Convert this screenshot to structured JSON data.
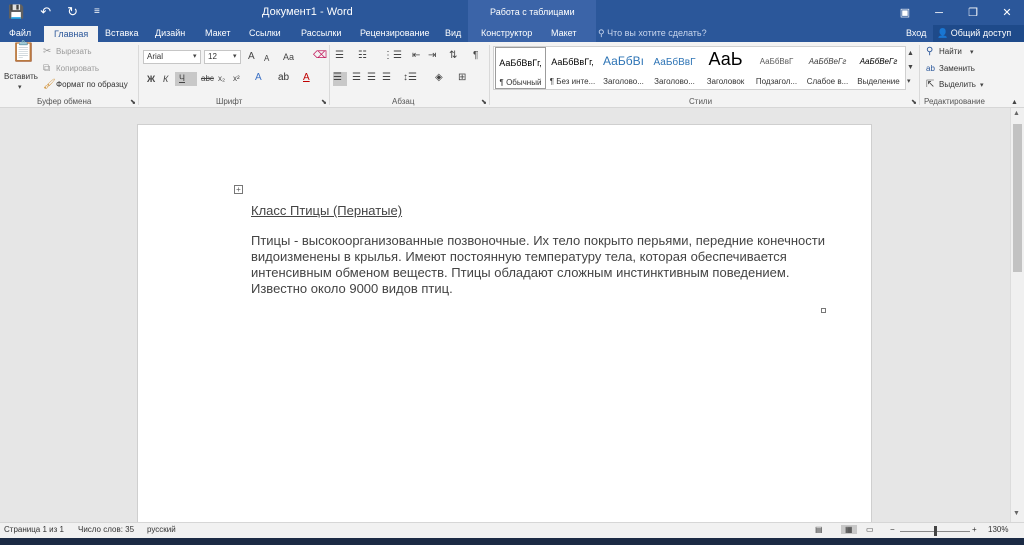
{
  "app": {
    "title": "Документ1 - Word",
    "context_tab_title": "Работа с таблицами",
    "qat": {
      "save": "💾",
      "undo": "↶",
      "redo": "↻",
      "customize": "≡"
    }
  },
  "tabs": [
    "Файл",
    "Главная",
    "Вставка",
    "Дизайн",
    "Макет",
    "Ссылки",
    "Рассылки",
    "Рецензирование",
    "Вид",
    "Конструктор",
    "Макет"
  ],
  "tell_me": "Что вы хотите сделать?",
  "sign_in": "Вход",
  "share": "Общий доступ",
  "ribbon": {
    "clipboard": {
      "label": "Буфер обмена",
      "paste": "Вставить",
      "cut": "Вырезать",
      "copy": "Копировать",
      "format_painter": "Формат по образцу"
    },
    "font": {
      "label": "Шрифт",
      "font_name": "Arial",
      "font_size": "12",
      "bold": "Ж",
      "italic": "К",
      "underline": "Ч",
      "strike": "abc",
      "subscript": "x₂",
      "superscript": "x²",
      "grow": "A",
      "shrink": "A",
      "case": "Aa"
    },
    "paragraph": {
      "label": "Абзац"
    },
    "styles": {
      "label": "Стили",
      "items": [
        {
          "sample": "АаБбВвГг,",
          "name": "¶ Обычный"
        },
        {
          "sample": "АаБбВвГг,",
          "name": "¶ Без инте..."
        },
        {
          "sample": "АаБбВı",
          "name": "Заголово..."
        },
        {
          "sample": "АаБбВвГ",
          "name": "Заголово..."
        },
        {
          "sample": "АаЬ",
          "name": "Заголовок"
        },
        {
          "sample": "АаБбВвГ",
          "name": "Подзагол..."
        },
        {
          "sample": "АаБбВеГг",
          "name": "Слабое в..."
        },
        {
          "sample": "АаБбВеГг",
          "name": "Выделение"
        }
      ]
    },
    "editing": {
      "label": "Редактирование",
      "find": "Найти",
      "replace": "Заменить",
      "select": "Выделить"
    }
  },
  "document": {
    "heading": "Класс Птицы (Пернатые)",
    "paragraph": "Птицы - высокоорганизованные позвоночные. Их тело покрыто перьями, передние конечности видоизменены в крылья. Имеют постоянную температуру тела, которая обеспечивается интенсивным обменом веществ. Птицы обладают сложным инстинктивным поведением. Известно около 9000 видов птиц."
  },
  "status": {
    "page": "Страница 1 из 1",
    "words": "Число слов: 35",
    "language": "русский",
    "zoom": "130%",
    "zoom_minus": "−",
    "zoom_plus": "+"
  },
  "colors": {
    "accent": "#2b579a"
  }
}
